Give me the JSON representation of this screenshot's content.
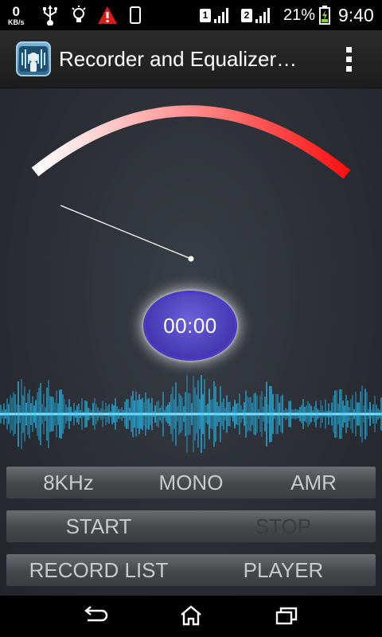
{
  "status_bar": {
    "data_rate_value": "0",
    "data_rate_unit": "KB/s",
    "sim1": "1",
    "sim2": "2",
    "battery_percent": "21%",
    "time": "9:40",
    "icons": [
      "usb-icon",
      "lightbulb-icon",
      "warning-icon",
      "phone-icon",
      "signal-icon",
      "battery-icon"
    ]
  },
  "app_bar": {
    "title": "Recorder and Equalizer…",
    "icon": "app-icon",
    "menu_icon": "overflow-menu-icon"
  },
  "meter": {
    "arc_start_color": "#ffffff",
    "arc_end_color": "#ff1a1a"
  },
  "timer": {
    "value": "00:00"
  },
  "settings_row": {
    "sample_rate": "8KHz",
    "channel": "MONO",
    "format": "AMR"
  },
  "controls_row": {
    "start_label": "START",
    "stop_label": "STOP"
  },
  "nav_row": {
    "record_list_label": "RECORD LIST",
    "player_label": "PLAYER"
  },
  "colors": {
    "accent_wave": "#22c8ff",
    "timer_fill": "#5a4cc8",
    "button_text": "#c9cacc"
  }
}
